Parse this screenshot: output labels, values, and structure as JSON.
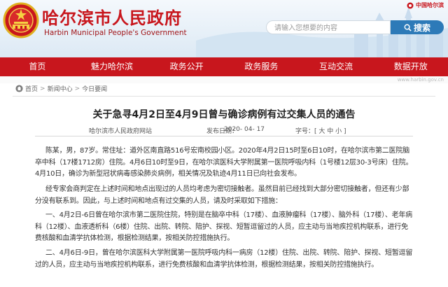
{
  "header": {
    "title": "哈尔滨市人民政府",
    "subtitle": "Harbin Municipal People's Government",
    "logo_text": "中国哈尔滨",
    "logo_url": "www.harbin.gov.cn",
    "search_placeholder": "请输入您想要的内容",
    "search_button": "搜索"
  },
  "nav": {
    "items": [
      {
        "label": "首页"
      },
      {
        "label": "魅力哈尔滨"
      },
      {
        "label": "政务公开"
      },
      {
        "label": "政务服务"
      },
      {
        "label": "互动交流"
      },
      {
        "label": "数据开放"
      }
    ]
  },
  "url_strip": "www.harbin.gov.cn",
  "breadcrumb": {
    "home": "首页",
    "news": "新闻中心",
    "today": "今日要闻"
  },
  "article": {
    "title": "关于急寻4月2日至4月9日曾与确诊病例有过交集人员的通告",
    "source": "哈尔滨市人民政府网站",
    "date_label": "发布日期：",
    "date": "2020- 04- 17",
    "font_size_label": "字号：[ 大 中 小 ]",
    "paragraphs": [
      "陈某，男，87岁。常住址：道外区南直路516号宏南校园小区。2020年4月2日15时至6日10时，在哈尔滨市第二医院脑卒中科（17楼1712房）住院。4月6日10时至9日，在哈尔滨医科大学附属第一医院呼吸内科（1号楼12层30-3号床）住院。4月10日，确诊为新型冠状病毒感染肺炎病例，相关情况及轨迹4月11日已向社会发布。",
      "经专家会商判定在上述时间和地点出现过的人员均考虑为密切接触者。虽然目前已经找到大部分密切接触者，但还有少部分没有联系到。因此，与上述时间和地点有过交集的人员，请及时采取如下措施：",
      "一、4月2日-6日曾在哈尔滨市第二医院住院，特别是在脑卒中科（17楼）、血液肿瘤科（17楼）、脑外科（17楼）、老年病科（12楼）、血液透析科（6楼）住院、出院、转院、陪护、探视、短暂逗留过的人员，应主动与当地疾控机构联系，进行免费核酸和血清学抗体检测，根据检测结果，按相关防控措施执行。",
      "二、4月6日-9日，曾在哈尔滨医科大学附属第一医院呼吸内科一病房（12楼）住院、出院、转院、陪护、探视、短暂逗留过的人员，应主动与当地疾控机构联系，进行免费核酸和血清学抗体检测，根据检测结果，按相关防控措施执行。"
    ]
  },
  "colors": {
    "brand_red": "#c8161d",
    "search_blue": "#2d7ab8"
  },
  "icons": {
    "emblem": "national-emblem-icon",
    "home": "home-icon",
    "search": "search-icon"
  }
}
